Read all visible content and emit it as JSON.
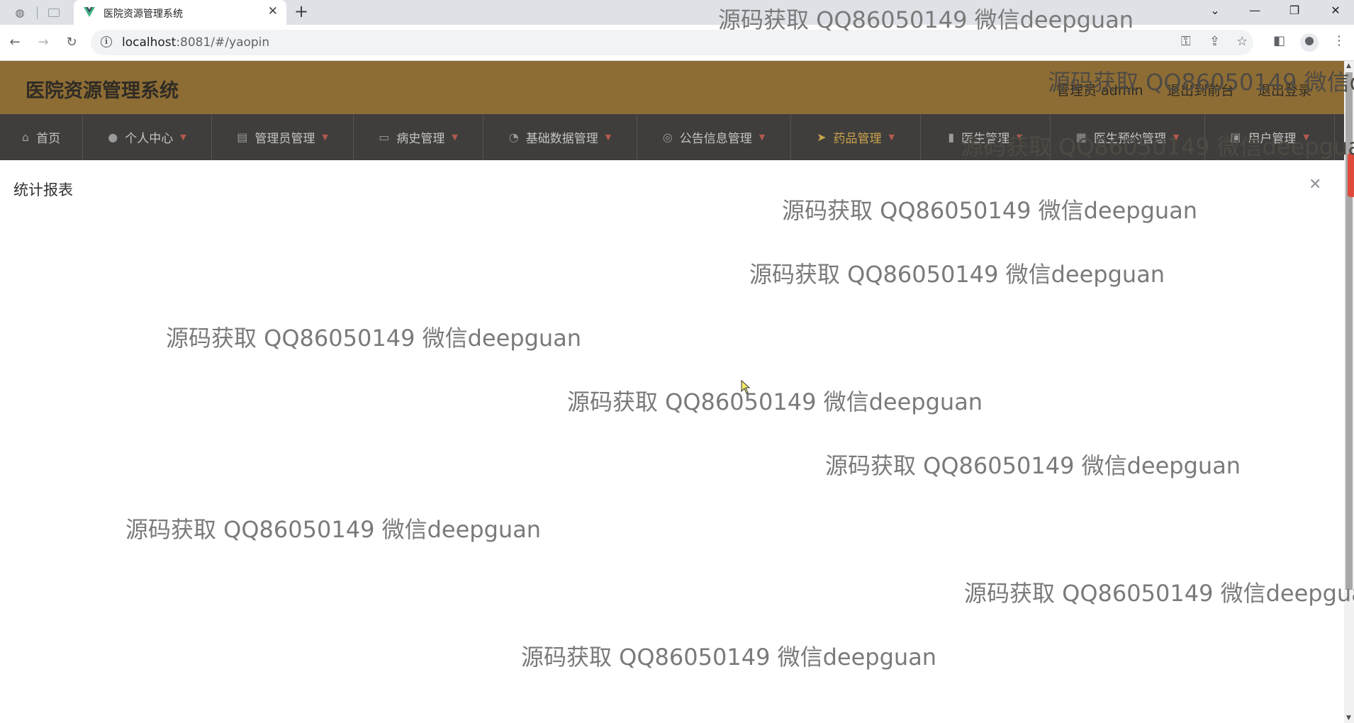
{
  "browser": {
    "tab_title": "医院资源管理系统",
    "url_host": "localhost",
    "url_rest": ":8081/#/yaopin"
  },
  "header": {
    "title": "医院资源管理系统",
    "admin_label": "管理员 admin",
    "front_link": "退出到前台",
    "logout_link": "退出登录"
  },
  "menu": [
    {
      "label": "首页",
      "icon": "home-icon",
      "caret": false
    },
    {
      "label": "个人中心",
      "icon": "user-icon",
      "caret": true
    },
    {
      "label": "管理员管理",
      "icon": "briefcase-icon",
      "caret": true
    },
    {
      "label": "病史管理",
      "icon": "chat-icon",
      "caret": true
    },
    {
      "label": "基础数据管理",
      "icon": "gauge-icon",
      "caret": true
    },
    {
      "label": "公告信息管理",
      "icon": "globe-icon",
      "caret": true
    },
    {
      "label": "药品管理",
      "icon": "send-icon",
      "caret": true,
      "active": true
    },
    {
      "label": "医生管理",
      "icon": "clipboard-icon",
      "caret": true
    },
    {
      "label": "医生预约管理",
      "icon": "calendar-icon",
      "caret": true
    },
    {
      "label": "用户管理",
      "icon": "card-icon",
      "caret": true
    }
  ],
  "content": {
    "title": "统计报表"
  },
  "watermark": "源码获取 QQ86050149 微信deepguan",
  "colors": {
    "header_bg": "#8e6d35",
    "menu_bg": "#3f3e3c",
    "menu_active": "#c9a24c",
    "caret": "#b35a4d"
  }
}
